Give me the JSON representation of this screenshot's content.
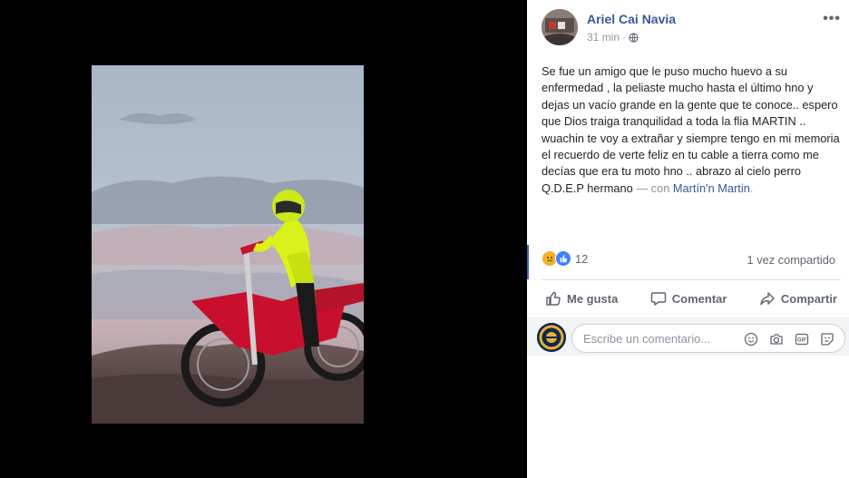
{
  "post": {
    "author": "Ariel Cai Navia",
    "time": "31 min",
    "time_separator": "·",
    "more_label": "•••",
    "text": "Se fue un amigo que le puso mucho huevo a su enfermedad , la peliaste mucho hasta el último hno y dejas un vacío grande en la gente que te conoce.. espero que Dios traiga tranquilidad a toda la flia MARTIN .. wuachin te voy a extrañar y siempre tengo en mi memoria el recuerdo de verte feliz en tu cable a tierra como me decías que era tu moto hno .. abrazo al cielo perro",
    "closing": "Q.D.E.P hermano ",
    "with_label": "— con ",
    "tagged_user": "Martín'n Martin",
    "tagged_suffix": "."
  },
  "stats": {
    "reaction_count": "12",
    "shares": "1 vez compartido"
  },
  "actions": {
    "like": "Me gusta",
    "comment": "Comentar",
    "share": "Compartir"
  },
  "comment_box": {
    "placeholder": "Escribe un comentario..."
  },
  "icons": {
    "like_icon": "thumbs-up-icon",
    "comment_icon": "speech-bubble-icon",
    "share_icon": "share-arrow-icon",
    "emoji_icon": "smiley-icon",
    "camera_icon": "camera-icon",
    "gif_icon": "gif-icon",
    "sticker_icon": "sticker-icon"
  },
  "colors": {
    "link_blue": "#385898",
    "meta_gray": "#90949c",
    "like_blue": "#4080ff",
    "sad_yellow": "#f7b125"
  }
}
